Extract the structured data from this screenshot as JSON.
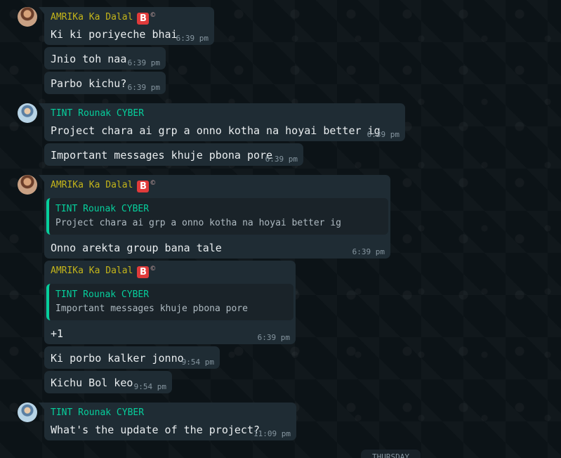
{
  "colors": {
    "amrika_name": "#c4b51a",
    "tint_name": "#06cf9c",
    "bubble": "#1f2c34",
    "background": "#0c1317"
  },
  "senders": {
    "amrika": "AMRIKa Ka Dalal",
    "amrika_badge": "B",
    "amrika_badge_mark": "©",
    "tint": "TINT Rounak CYBER"
  },
  "messages": [
    {
      "text": "Ki ki poriyeche bhai",
      "time": "6:39 pm"
    },
    {
      "text": "Jnio toh naa",
      "time": "6:39 pm"
    },
    {
      "text": "Parbo kichu?",
      "time": "6:39 pm"
    },
    {
      "text": "Project chara ai grp a onno kotha na hoyai better ig",
      "time": "6:39 pm"
    },
    {
      "text": "Important messages khuje pbona pore",
      "time": "6:39 pm"
    },
    {
      "quote_sender": "TINT Rounak CYBER",
      "quote_text": "Project chara ai grp a onno kotha na hoyai better ig",
      "text": "Onno arekta group bana tale",
      "time": "6:39 pm"
    },
    {
      "quote_sender": "TINT Rounak CYBER",
      "quote_text": "Important messages khuje pbona pore",
      "text": "+1",
      "time": "6:39 pm"
    },
    {
      "text": "Ki porbo kalker jonno",
      "time": "9:54 pm"
    },
    {
      "text": "Kichu Bol keo",
      "time": "9:54 pm"
    },
    {
      "text": "What's the update of the project?",
      "time": "11:09 pm"
    }
  ],
  "date_divider": "THURSDAY"
}
